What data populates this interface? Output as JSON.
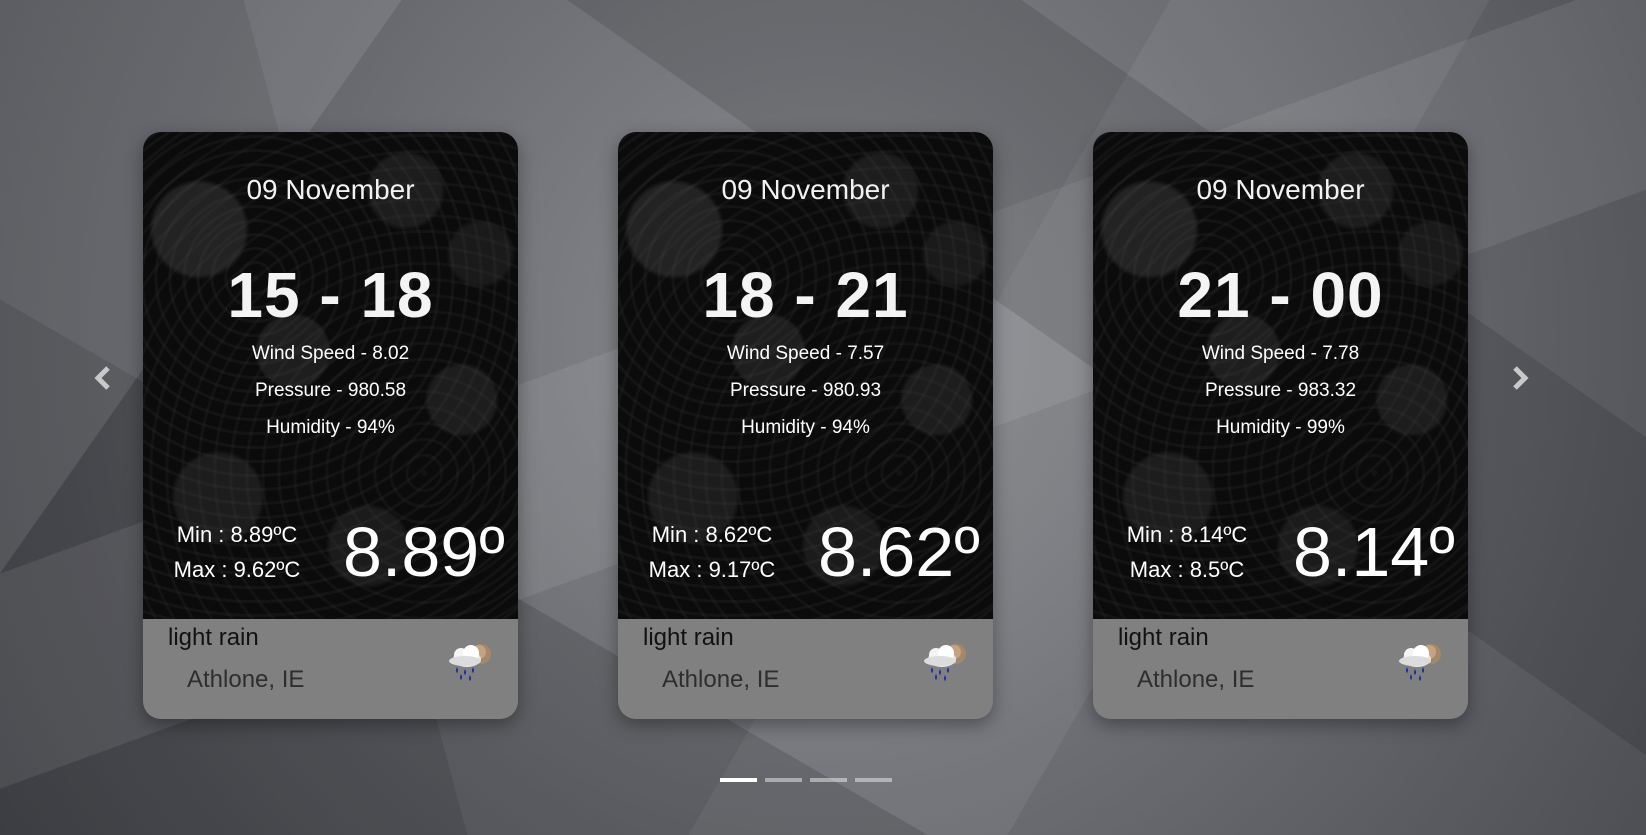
{
  "carousel": {
    "prev_icon": "chevron-left-icon",
    "next_icon": "chevron-right-icon",
    "indicator_count": 4,
    "active_indicator": 0,
    "cards": [
      {
        "date": "09 November",
        "time_range": "15 - 18",
        "wind_speed": "Wind Speed - 8.02",
        "pressure": "Pressure - 980.58",
        "humidity": "Humidity - 94%",
        "min": "Min : 8.89ºC",
        "max": "Max : 9.62ºC",
        "temp": "8.89º",
        "description": "light rain",
        "location": "Athlone, IE",
        "icon": "light-rain-icon"
      },
      {
        "date": "09 November",
        "time_range": "18 - 21",
        "wind_speed": "Wind Speed - 7.57",
        "pressure": "Pressure - 980.93",
        "humidity": "Humidity - 94%",
        "min": "Min : 8.62ºC",
        "max": "Max : 9.17ºC",
        "temp": "8.62º",
        "description": "light rain",
        "location": "Athlone, IE",
        "icon": "light-rain-icon"
      },
      {
        "date": "09 November",
        "time_range": "21 - 00",
        "wind_speed": "Wind Speed - 7.78",
        "pressure": "Pressure - 983.32",
        "humidity": "Humidity - 99%",
        "min": "Min : 8.14ºC",
        "max": "Max : 8.5ºC",
        "temp": "8.14º",
        "description": "light rain",
        "location": "Athlone, IE",
        "icon": "light-rain-icon"
      }
    ]
  },
  "colors": {
    "card_top": "#0b0b0b",
    "card_bottom": "#808080",
    "text_light": "#ffffff",
    "indicator_active": "#ffffff",
    "rain_drops": "#1a2aa6"
  }
}
